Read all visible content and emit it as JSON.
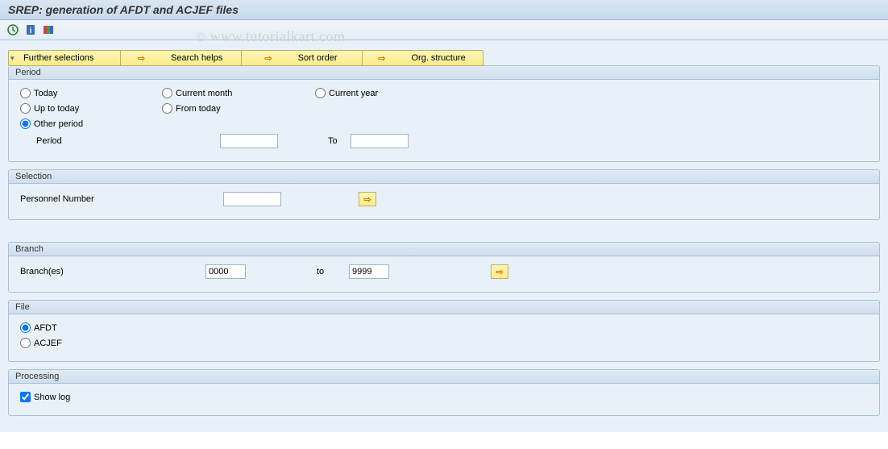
{
  "title": "SREP: generation of AFDT and ACJEF files",
  "watermark": "www.tutorialkart.com",
  "toolbar_icons": [
    "execute",
    "info",
    "variants"
  ],
  "buttons": {
    "further_selections": "Further selections",
    "search_helps": "Search helps",
    "sort_order": "Sort order",
    "org_structure": "Org. structure"
  },
  "period": {
    "header": "Period",
    "today": "Today",
    "current_month": "Current month",
    "current_year": "Current year",
    "up_to_today": "Up to today",
    "from_today": "From today",
    "other_period": "Other period",
    "period_label": "Period",
    "period_from": "",
    "to_label": "To",
    "period_to": "",
    "selected": "other_period"
  },
  "selection": {
    "header": "Selection",
    "personnel_number_label": "Personnel Number",
    "personnel_number_value": ""
  },
  "branch": {
    "header": "Branch",
    "label": "Branch(es)",
    "from": "0000",
    "to_label": "to",
    "to": "9999"
  },
  "file": {
    "header": "File",
    "afdt": "AFDT",
    "acjef": "ACJEF",
    "selected": "afdt"
  },
  "processing": {
    "header": "Processing",
    "show_log": "Show log",
    "show_log_checked": true
  }
}
